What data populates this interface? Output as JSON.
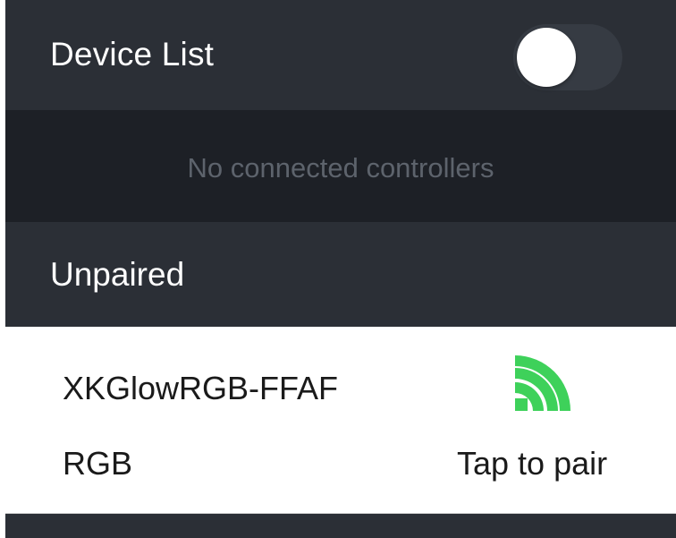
{
  "header": {
    "title": "Device List",
    "toggle_state": "off"
  },
  "connected": {
    "empty_message": "No connected controllers"
  },
  "unpaired": {
    "section_title": "Unpaired",
    "devices": [
      {
        "name": "XKGlowRGB-FFAF",
        "type": "RGB",
        "action_label": "Tap to pair",
        "icon": "signal-strength-icon"
      }
    ]
  },
  "colors": {
    "header_bg": "#2b2f36",
    "empty_bg": "#1d2026",
    "signal_green": "#3ed15a",
    "muted_text": "#5d636c"
  }
}
